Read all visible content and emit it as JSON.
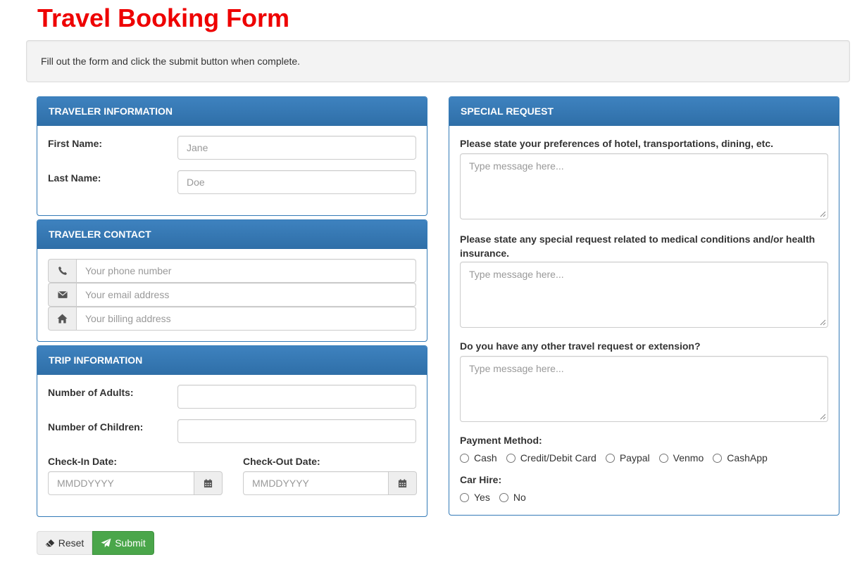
{
  "page": {
    "title": "Travel Booking Form",
    "instructions": "Fill out the form and click the submit button when complete."
  },
  "traveler_info": {
    "heading": "TRAVELER INFORMATION",
    "first_name_label": "First Name:",
    "first_name_placeholder": "Jane",
    "last_name_label": "Last Name:",
    "last_name_placeholder": "Doe"
  },
  "traveler_contact": {
    "heading": "TRAVELER CONTACT",
    "phone_placeholder": "Your phone number",
    "email_placeholder": "Your email address",
    "address_placeholder": "Your billing address",
    "icons": [
      "phone-icon",
      "envelope-icon",
      "home-icon"
    ]
  },
  "trip_info": {
    "heading": "TRIP INFORMATION",
    "adults_label": "Number of Adults:",
    "adults_value": "",
    "children_label": "Number of Children:",
    "children_value": "",
    "checkin_label": "Check-In Date:",
    "checkin_placeholder": "MMDDYYYY",
    "checkout_label": "Check-Out Date:",
    "checkout_placeholder": "MMDDYYYY"
  },
  "special_request": {
    "heading": "SPECIAL REQUEST",
    "q1": "Please state your preferences of hotel, transportations, dining, etc.",
    "q1_placeholder": "Type message here...",
    "q2": "Please state any special request related to medical conditions and/or health insurance.",
    "q2_placeholder": "Type message here...",
    "q3": "Do you have any other travel request or extension?",
    "q3_placeholder": "Type message here...",
    "payment_label": "Payment Method:",
    "payment_options": [
      "Cash",
      "Credit/Debit Card",
      "Paypal",
      "Venmo",
      "CashApp"
    ],
    "car_hire_label": "Car Hire:",
    "car_hire_options": [
      "Yes",
      "No"
    ]
  },
  "buttons": {
    "reset_label": "Reset",
    "submit_label": "Submit"
  },
  "colors": {
    "title": "#ee0000",
    "panel_heading": "#337ab7",
    "submit": "#4aa64a"
  }
}
